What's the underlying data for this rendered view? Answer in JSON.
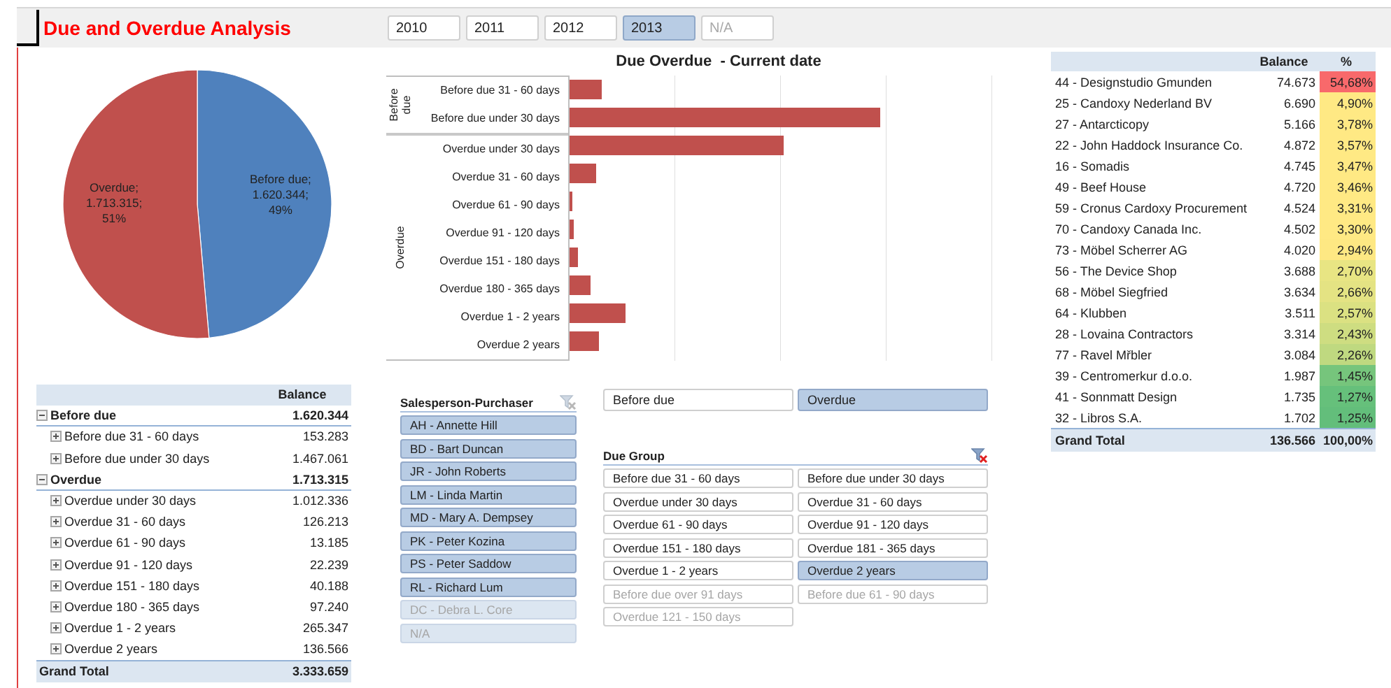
{
  "header": {
    "title": "Due and Overdue Analysis",
    "years": [
      {
        "label": "2010",
        "selected": false,
        "disabled": false
      },
      {
        "label": "2011",
        "selected": false,
        "disabled": false
      },
      {
        "label": "2012",
        "selected": false,
        "disabled": false
      },
      {
        "label": "2013",
        "selected": true,
        "disabled": false
      },
      {
        "label": "N/A",
        "selected": false,
        "disabled": true
      }
    ]
  },
  "pie": {
    "slices": [
      {
        "label": "Before due; 1.620.344; 49%",
        "color": "#4f81bd"
      },
      {
        "label": "Overdue; 1.713.315; 51%",
        "color": "#c0504d"
      }
    ]
  },
  "pivot": {
    "columns": [
      "Balance"
    ],
    "groups": [
      {
        "label": "Before due",
        "value": "1.620.344",
        "expanded": true,
        "children": [
          {
            "label": "Before due 31 - 60 days",
            "value": "153.283",
            "expanded": false
          },
          {
            "label": "Before due under 30 days",
            "value": "1.467.061",
            "expanded": false
          }
        ]
      },
      {
        "label": "Overdue",
        "value": "1.713.315",
        "expanded": true,
        "children": [
          {
            "label": "Overdue under 30 days",
            "value": "1.012.336",
            "expanded": false
          },
          {
            "label": "Overdue 31 - 60 days",
            "value": "126.213",
            "expanded": false
          },
          {
            "label": "Overdue 61 - 90 days",
            "value": "13.185",
            "expanded": false
          },
          {
            "label": "Overdue 91 - 120 days",
            "value": "22.239",
            "expanded": false
          },
          {
            "label": "Overdue 151 - 180 days",
            "value": "40.188",
            "expanded": false
          },
          {
            "label": "Overdue 180 - 365 days",
            "value": "97.240",
            "expanded": false
          },
          {
            "label": "Overdue 1 - 2 years",
            "value": "265.347",
            "expanded": false
          },
          {
            "label": "Overdue 2 years",
            "value": "136.566",
            "expanded": false
          }
        ]
      }
    ],
    "total": {
      "label": "Grand Total",
      "value": "3.333.659"
    }
  },
  "bar_chart": {
    "title": "Due Overdue  - Current date",
    "groups": [
      {
        "label": "Before due",
        "categories": [
          "Before due 31 - 60 days",
          "Before due under 30 days"
        ]
      },
      {
        "label": "Overdue",
        "categories": [
          "Overdue under 30 days",
          "Overdue 31 - 60 days",
          "Overdue 61 - 90 days",
          "Overdue 91 - 120 days",
          "Overdue 151 - 180 days",
          "Overdue 180 - 365 days",
          "Overdue 1 - 2 years",
          "Overdue 2 years"
        ]
      }
    ]
  },
  "customers": {
    "columns": [
      "Balance",
      "%"
    ],
    "rows": [
      {
        "name": "44 - Designstudio Gmunden",
        "balance": "74.673",
        "percent": "54,68%",
        "color": "#f8696b"
      },
      {
        "name": "25 - Candoxy Nederland BV",
        "balance": "6.690",
        "percent": "4,90%",
        "color": "#ffe984"
      },
      {
        "name": "27 - Antarcticopy",
        "balance": "5.166",
        "percent": "3,78%",
        "color": "#ffe984"
      },
      {
        "name": "22 - John Haddock Insurance Co.",
        "balance": "4.872",
        "percent": "3,57%",
        "color": "#ffe984"
      },
      {
        "name": "16 - Somadis",
        "balance": "4.745",
        "percent": "3,47%",
        "color": "#ffe984"
      },
      {
        "name": "49 - Beef House",
        "balance": "4.720",
        "percent": "3,46%",
        "color": "#ffe984"
      },
      {
        "name": "59 - Cronus Cardoxy Procurement",
        "balance": "4.524",
        "percent": "3,31%",
        "color": "#ffe984"
      },
      {
        "name": "70 - Candoxy Canada Inc.",
        "balance": "4.502",
        "percent": "3,30%",
        "color": "#ffe984"
      },
      {
        "name": "73 - Möbel Scherrer AG",
        "balance": "4.020",
        "percent": "2,94%",
        "color": "#fee883"
      },
      {
        "name": "56 - The Device Shop",
        "balance": "3.688",
        "percent": "2,70%",
        "color": "#e8e583"
      },
      {
        "name": "68 - Möbel Siegfried",
        "balance": "3.634",
        "percent": "2,66%",
        "color": "#e4e383"
      },
      {
        "name": "64 - Klubben",
        "balance": "3.511",
        "percent": "2,57%",
        "color": "#dbe182"
      },
      {
        "name": "28 - Lovaina Contractors",
        "balance": "3.314",
        "percent": "2,43%",
        "color": "#cedd81"
      },
      {
        "name": "77 - Ravel Mřbler",
        "balance": "3.084",
        "percent": "2,26%",
        "color": "#bfd980"
      },
      {
        "name": "39 - Centromerkur d.o.o.",
        "balance": "1.987",
        "percent": "1,45%",
        "color": "#76c57c"
      },
      {
        "name": "41 - Sonnmatt Design",
        "balance": "1.735",
        "percent": "1,27%",
        "color": "#66c07b"
      },
      {
        "name": "32 - Libros S.A.",
        "balance": "1.702",
        "percent": "1,25%",
        "color": "#63be7b"
      }
    ],
    "total": {
      "name": "Grand Total",
      "balance": "136.566",
      "percent": "100,00%"
    }
  },
  "salesperson_slicer": {
    "title": "Salesperson-Purchaser",
    "filter_active": false,
    "items": [
      {
        "label": "AH - Annette Hill",
        "selected": true,
        "disabled": false
      },
      {
        "label": "BD - Bart Duncan",
        "selected": true,
        "disabled": false
      },
      {
        "label": "JR - John Roberts",
        "selected": true,
        "disabled": false
      },
      {
        "label": "LM - Linda Martin",
        "selected": true,
        "disabled": false
      },
      {
        "label": "MD - Mary A. Dempsey",
        "selected": true,
        "disabled": false
      },
      {
        "label": "PK - Peter Kozina",
        "selected": true,
        "disabled": false
      },
      {
        "label": "PS - Peter Saddow",
        "selected": true,
        "disabled": false
      },
      {
        "label": "RL - Richard Lum",
        "selected": true,
        "disabled": false
      },
      {
        "label": "DC - Debra L. Core",
        "selected": true,
        "disabled": true
      },
      {
        "label": "N/A",
        "selected": true,
        "disabled": true
      }
    ]
  },
  "status_slicer": {
    "items": [
      {
        "label": "Before due",
        "selected": false,
        "disabled": false
      },
      {
        "label": "Overdue",
        "selected": true,
        "disabled": false
      }
    ]
  },
  "due_group_slicer": {
    "title": "Due Group",
    "filter_active": true,
    "items": [
      {
        "label": "Before due 31 - 60 days",
        "selected": false,
        "disabled": false
      },
      {
        "label": "Before due under 30 days",
        "selected": false,
        "disabled": false
      },
      {
        "label": "Overdue under 30 days",
        "selected": false,
        "disabled": false
      },
      {
        "label": "Overdue 31 - 60 days",
        "selected": false,
        "disabled": false
      },
      {
        "label": "Overdue 61 - 90 days",
        "selected": false,
        "disabled": false
      },
      {
        "label": "Overdue 91 - 120 days",
        "selected": false,
        "disabled": false
      },
      {
        "label": "Overdue 151 - 180 days",
        "selected": false,
        "disabled": false
      },
      {
        "label": "Overdue 181 - 365 days",
        "selected": false,
        "disabled": false
      },
      {
        "label": "Overdue 1 - 2 years",
        "selected": false,
        "disabled": false
      },
      {
        "label": "Overdue 2 years",
        "selected": true,
        "disabled": false
      },
      {
        "label": "Before due over 91 days",
        "selected": false,
        "disabled": true
      },
      {
        "label": "Before due 61 - 90 days",
        "selected": false,
        "disabled": true
      },
      {
        "label": "Overdue 121 - 150 days",
        "selected": false,
        "disabled": true
      }
    ]
  }
}
